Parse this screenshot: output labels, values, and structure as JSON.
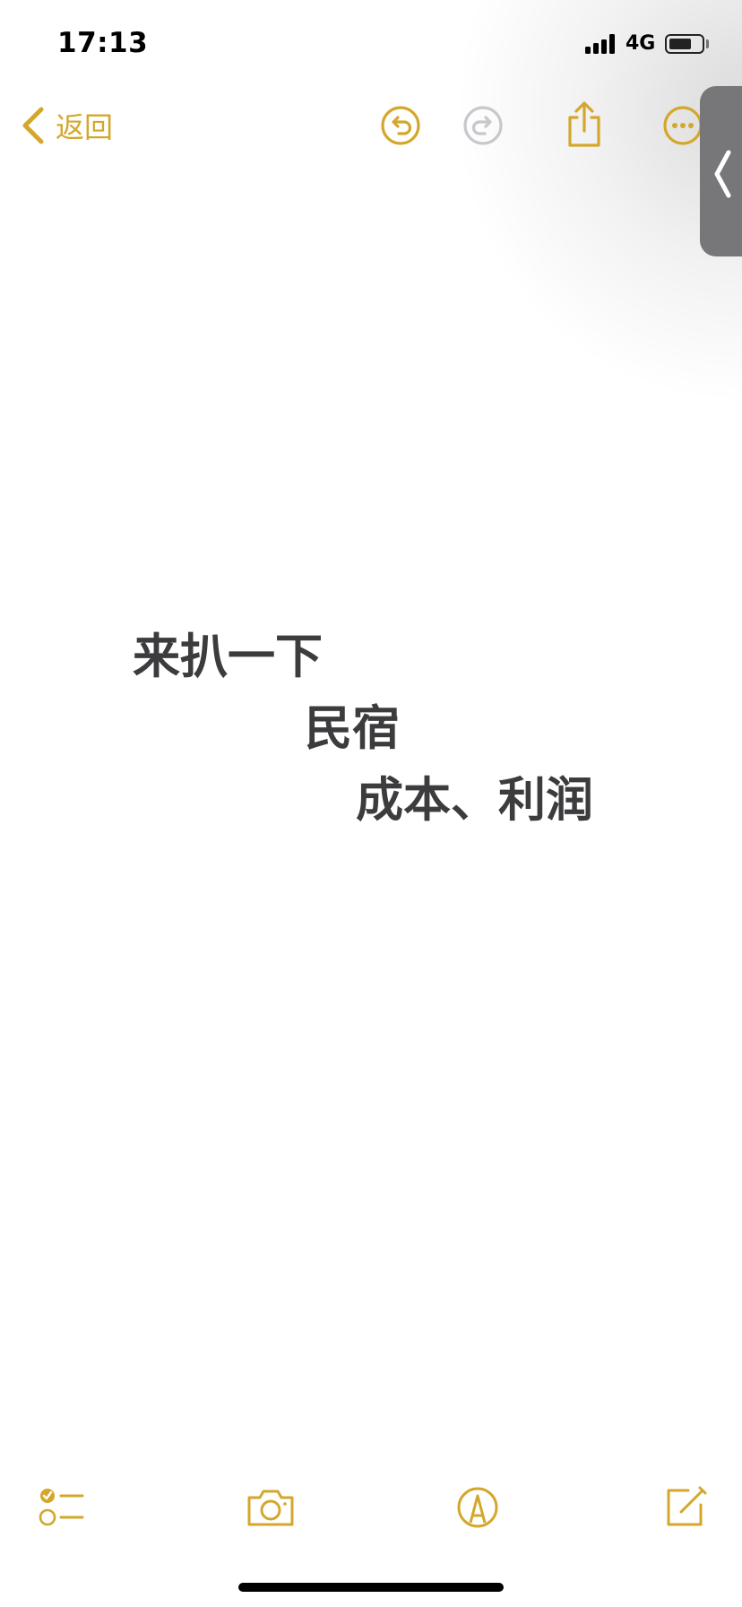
{
  "status_bar": {
    "time": "17:13",
    "network": "4G",
    "battery_level": 0.7,
    "signal_bars": 4
  },
  "nav": {
    "back_label": "返回",
    "icons": [
      "undo-icon",
      "redo-icon",
      "share-icon",
      "more-icon"
    ]
  },
  "note": {
    "lines": [
      "来扒一下",
      "民宿",
      "成本、利润"
    ]
  },
  "toolbar": {
    "icons": [
      "checklist-icon",
      "camera-icon",
      "markup-icon",
      "compose-icon"
    ]
  },
  "colors": {
    "accent": "#d4a72c",
    "accent_disabled": "#c7c7cc",
    "text": "#3c3c3e",
    "side_handle": "#777779"
  }
}
